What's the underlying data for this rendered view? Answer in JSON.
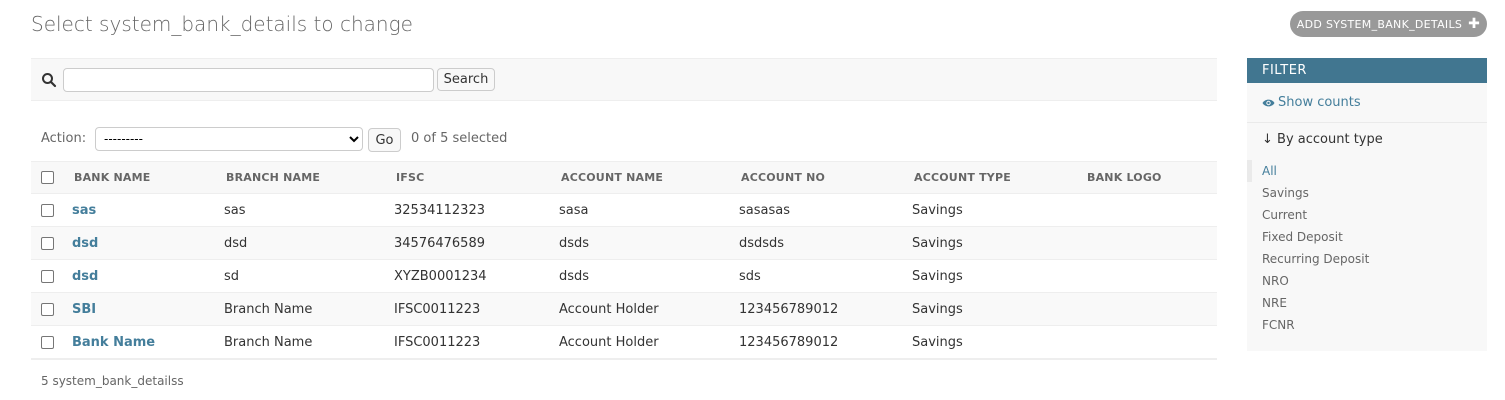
{
  "header": {
    "title": "Select system_bank_details to change",
    "add_button_label": "ADD SYSTEM_BANK_DETAILS"
  },
  "search": {
    "value": "",
    "placeholder": "",
    "button_label": "Search"
  },
  "actions": {
    "label": "Action:",
    "selected_option": "---------",
    "go_label": "Go",
    "counter": "0 of 5 selected"
  },
  "table": {
    "columns": [
      "BANK NAME",
      "BRANCH NAME",
      "IFSC",
      "ACCOUNT NAME",
      "ACCOUNT NO",
      "ACCOUNT TYPE",
      "BANK LOGO"
    ],
    "rows": [
      {
        "bank_name": "sas",
        "branch_name": "sas",
        "ifsc": "32534112323",
        "account_name": "sasa",
        "account_no": "sasasas",
        "account_type": "Savings"
      },
      {
        "bank_name": "dsd",
        "branch_name": "dsd",
        "ifsc": "34576476589",
        "account_name": "dsds",
        "account_no": "dsdsds",
        "account_type": "Savings"
      },
      {
        "bank_name": "dsd",
        "branch_name": "sd",
        "ifsc": "XYZB0001234",
        "account_name": "dsds",
        "account_no": "sds",
        "account_type": "Savings"
      },
      {
        "bank_name": "SBI",
        "branch_name": "Branch Name",
        "ifsc": "IFSC0011223",
        "account_name": "Account Holder",
        "account_no": "123456789012",
        "account_type": "Savings"
      },
      {
        "bank_name": "Bank Name",
        "branch_name": "Branch Name",
        "ifsc": "IFSC0011223",
        "account_name": "Account Holder",
        "account_no": "123456789012",
        "account_type": "Savings"
      }
    ]
  },
  "paginator": "5 system_bank_detailss",
  "filter": {
    "header": "FILTER",
    "show_counts": "Show counts",
    "section_title": "↓ By account type",
    "options": [
      "All",
      "Savings",
      "Current",
      "Fixed Deposit",
      "Recurring Deposit",
      "NRO",
      "NRE",
      "FCNR"
    ],
    "selected": "All"
  },
  "colors": {
    "link": "#447e9b",
    "filter_header_bg": "#417690",
    "add_button_bg": "#999999"
  }
}
